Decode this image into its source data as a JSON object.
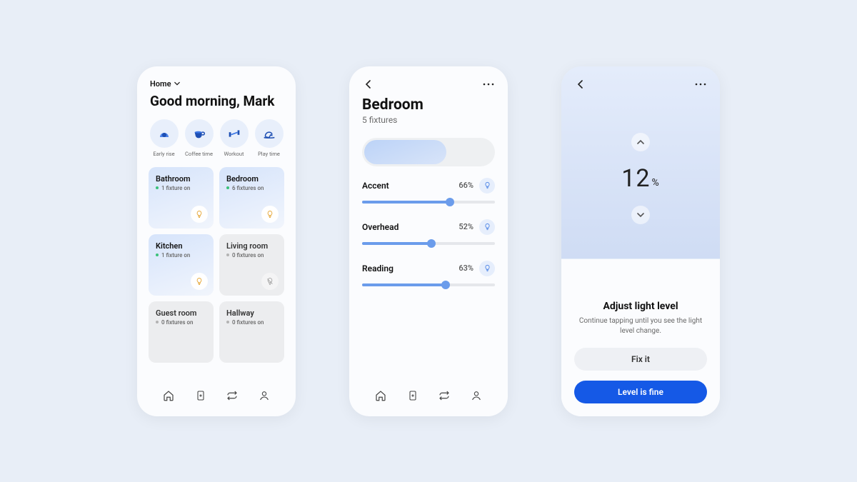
{
  "colors": {
    "accent": "#1559e6",
    "sliderFill": "#6b9ceb",
    "bulbOn": "#e6a93c",
    "statusGreen": "#3bc17a"
  },
  "home": {
    "selector_label": "Home",
    "greeting": "Good morning, Mark",
    "scenes": [
      {
        "label": "Early rise",
        "icon": "sunrise-icon"
      },
      {
        "label": "Coffee time",
        "icon": "coffee-icon"
      },
      {
        "label": "Workout",
        "icon": "dumbbell-icon"
      },
      {
        "label": "Play time",
        "icon": "horse-icon"
      }
    ],
    "rooms": [
      {
        "name": "Bathroom",
        "status": "1 fixture on",
        "on": true
      },
      {
        "name": "Bedroom",
        "status": "6 fixtures on",
        "on": true
      },
      {
        "name": "Kitchen",
        "status": "1 fixture on",
        "on": true
      },
      {
        "name": "Living room",
        "status": "0 fixtures on",
        "on": false
      },
      {
        "name": "Guest room",
        "status": "0 fixtures on",
        "on": false
      },
      {
        "name": "Hallway",
        "status": "0 fixtures on",
        "on": false
      }
    ],
    "nav": [
      {
        "name": "nav-home",
        "icon": "home-icon"
      },
      {
        "name": "nav-devices",
        "icon": "device-icon"
      },
      {
        "name": "nav-automations",
        "icon": "loop-icon"
      },
      {
        "name": "nav-profile",
        "icon": "user-icon"
      }
    ]
  },
  "room_detail": {
    "title": "Bedroom",
    "subtitle": "5 fixtures",
    "toggle_on": true,
    "fixtures": [
      {
        "name": "Accent",
        "percent": 66,
        "display": "66%"
      },
      {
        "name": "Overhead",
        "percent": 52,
        "display": "52%"
      },
      {
        "name": "Reading",
        "percent": 63,
        "display": "63%"
      }
    ]
  },
  "light_level": {
    "value": "12",
    "unit": "%",
    "sheet_title": "Adjust light level",
    "sheet_sub": "Continue tapping until you see the light level change.",
    "fix_label": "Fix it",
    "confirm_label": "Level is fine"
  }
}
